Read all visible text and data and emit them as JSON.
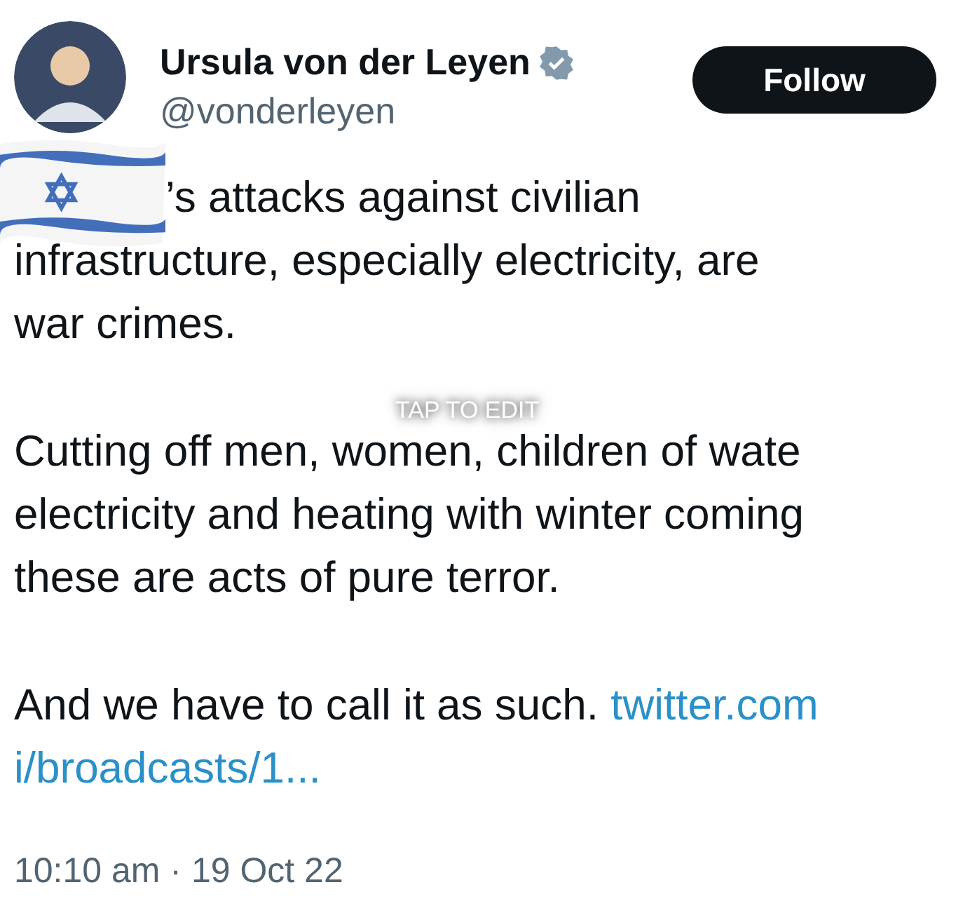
{
  "author": {
    "name": "Ursula von der Leyen",
    "verified": true,
    "handle": "@vonderleyen"
  },
  "follow_button": {
    "label": "Follow"
  },
  "sticker": {
    "kind": "flag"
  },
  "paragraphs": [
    {
      "lines": [
        [
          {
            "kind": "text",
            "text": "’s attacks against civilian"
          }
        ],
        [
          {
            "kind": "text",
            "text": "infrastructure, especially electricity, are"
          }
        ],
        [
          {
            "kind": "text",
            "text": "war crimes."
          }
        ]
      ]
    },
    {
      "lines": [
        [
          {
            "kind": "text",
            "text": "Cutting off men,"
          },
          {
            "kind": "text",
            "text": " women,"
          },
          {
            "kind": "text",
            "text": " children of wate"
          }
        ],
        [
          {
            "kind": "text",
            "text": "electricity and heating with winter coming"
          }
        ],
        [
          {
            "kind": "text",
            "text": "these are acts of pure terror."
          }
        ]
      ]
    },
    {
      "lines": [
        [
          {
            "kind": "text",
            "text": "And we have to call it as such. "
          },
          {
            "kind": "link",
            "text": "twitter.com"
          }
        ],
        [
          {
            "kind": "link",
            "text": "i/broadcasts/1..."
          }
        ]
      ]
    }
  ],
  "edit_hint": "TAP TO EDIT",
  "timestamp": "10:10 am · 19 Oct 22"
}
